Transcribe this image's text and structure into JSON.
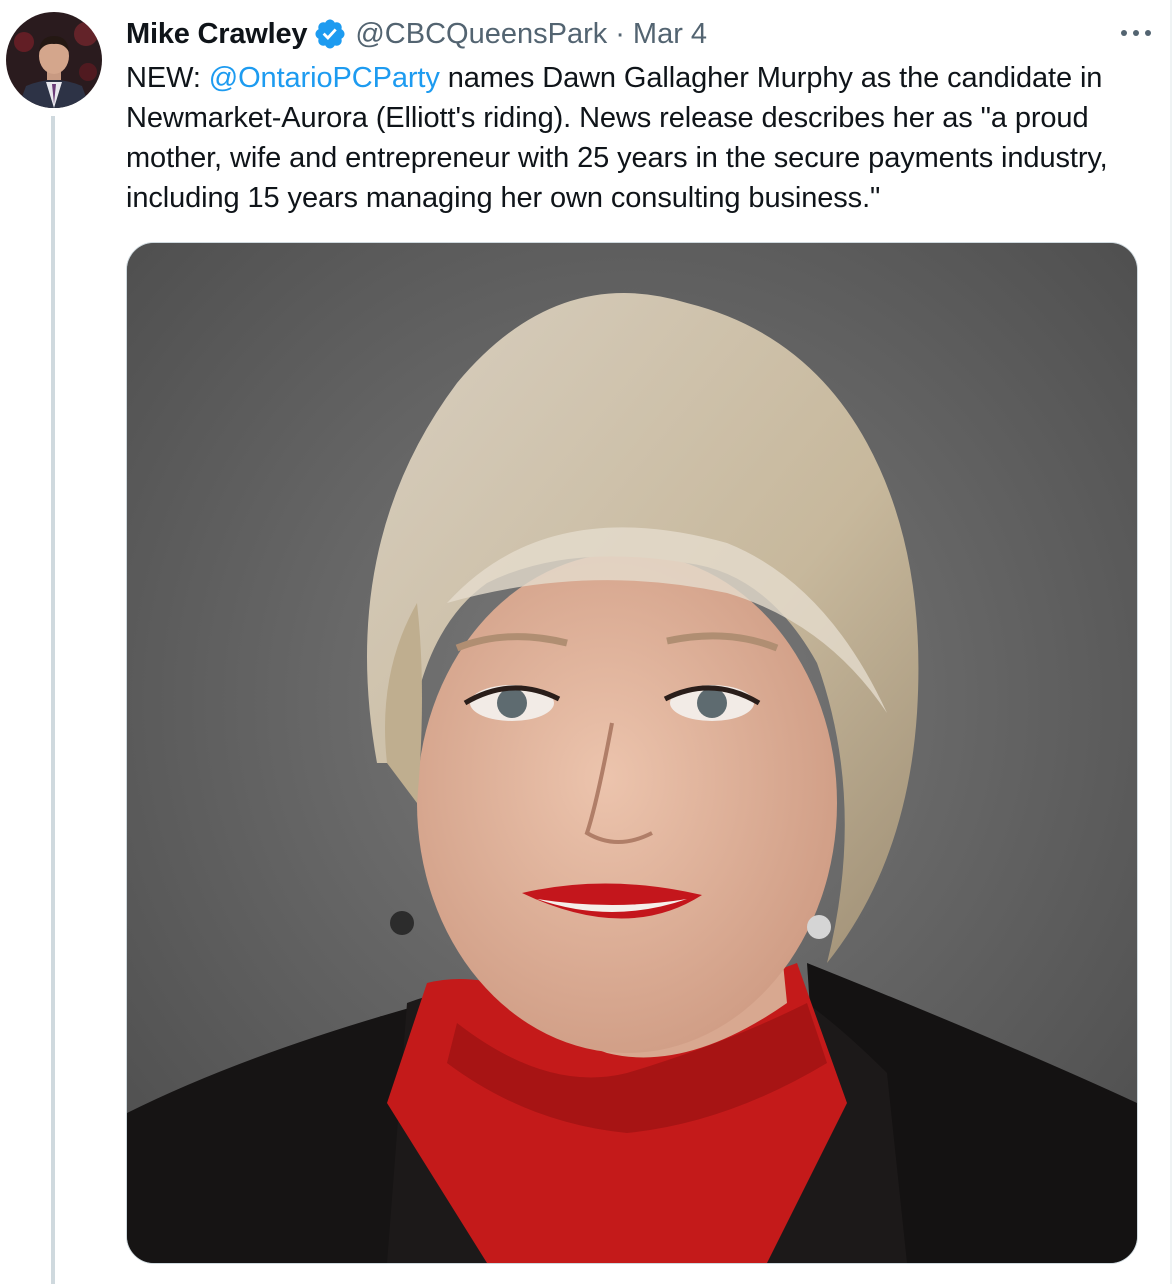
{
  "author": {
    "display_name": "Mike Crawley",
    "verified_icon": "verified-badge-icon",
    "handle": "@CBCQueensPark",
    "separator": "·",
    "date": "Mar 4"
  },
  "tweet": {
    "prefix": "NEW: ",
    "mention": "@OntarioPCParty",
    "body": " names Dawn Gallagher Murphy as the candidate in Newmarket-Aurora (Elliott's riding). News release describes her as \"a proud mother, wife and entrepreneur with 25 years in the secure payments industry, including 15 years managing her own consulting business.\""
  },
  "icons": {
    "more": "more-options-icon"
  },
  "colors": {
    "link": "#1d9bf0",
    "verified": "#1d9bf0",
    "text": "#0f1419",
    "muted": "#536471"
  }
}
